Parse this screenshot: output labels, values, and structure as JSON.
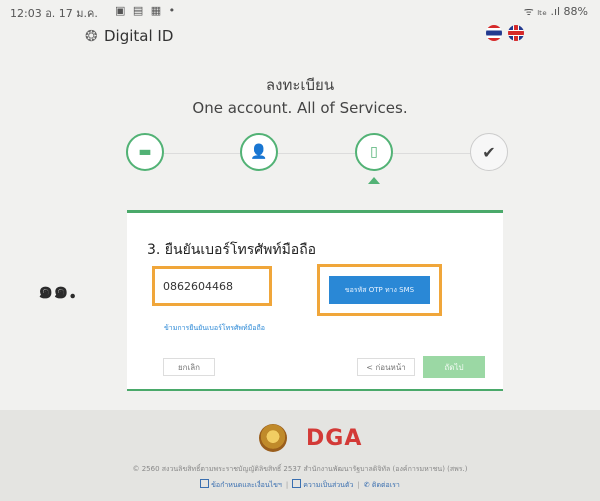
{
  "status_bar": {
    "time_date": "12:03 อ. 17 ม.ค.",
    "right": "ᯤ ₗₜₑ .ıl 88%"
  },
  "header": {
    "brand": "Digital ID",
    "logo_icon": "fingerprint-lion-logo",
    "flags": [
      "thai-flag",
      "uk-flag"
    ]
  },
  "page": {
    "title": "ลงทะเบียน",
    "subtitle": "One account. All of Services."
  },
  "stepper": {
    "steps": [
      {
        "icon": "card-icon",
        "glyph": "▬",
        "state": "done"
      },
      {
        "icon": "user-icon",
        "glyph": "👤",
        "state": "done"
      },
      {
        "icon": "phone-icon",
        "glyph": "▯",
        "state": "current"
      },
      {
        "icon": "check-icon",
        "glyph": "✔",
        "state": "todo"
      }
    ]
  },
  "form": {
    "heading": "3. ยืนยันเบอร์โทรศัพท์มือถือ",
    "phone_value": "0862604468",
    "otp_button": "ขอรหัส OTP ทาง SMS",
    "skip_link": "ข้ามการยืนยันเบอร์โทรศัพท์มือถือ",
    "cancel": "ยกเลิก",
    "back": "< ก่อนหน้า",
    "next": "ถัดไป"
  },
  "annotation": {
    "number": "๑๑."
  },
  "footer": {
    "logo_text": "DGA",
    "copyright": "© 2560 สงวนลิขสิทธิ์ตามพระราชบัญญัติลิขสิทธิ์ 2537 สำนักงานพัฒนารัฐบาลดิจิทัล (องค์การมหาชน) (สพร.)",
    "links": [
      "ข้อกำหนดและเงื่อนไขฯ",
      "ความเป็นส่วนตัว",
      "ติดต่อเรา"
    ]
  },
  "colors": {
    "accent_green": "#52b275",
    "highlight_orange": "#f0a63a",
    "button_blue": "#2a88d6",
    "next_green": "#9bd8a4",
    "dga_red": "#d33a37"
  }
}
